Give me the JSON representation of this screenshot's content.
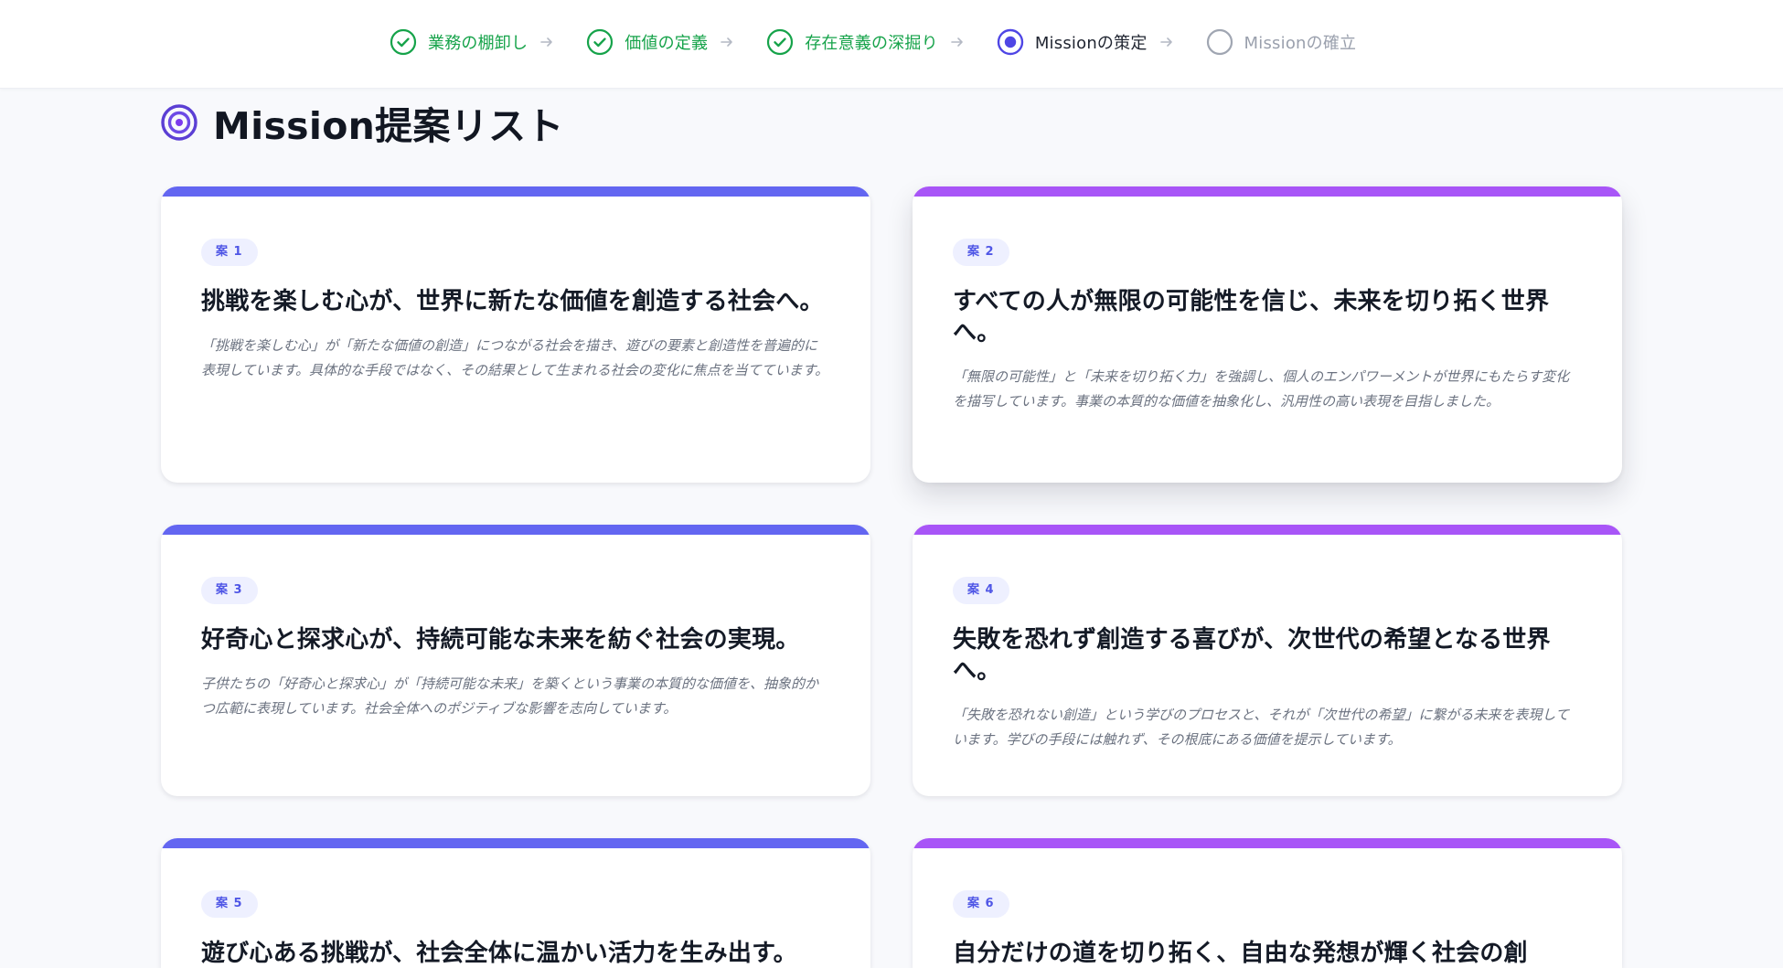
{
  "stepper": {
    "steps": [
      {
        "label": "業務の棚卸し",
        "state": "done",
        "icon": "check-circle-icon"
      },
      {
        "label": "価値の定義",
        "state": "done",
        "icon": "check-circle-icon"
      },
      {
        "label": "存在意義の深掘り",
        "state": "done",
        "icon": "check-circle-icon"
      },
      {
        "label": "Missionの策定",
        "state": "current",
        "icon": "dot-circle-icon"
      },
      {
        "label": "Missionの確立",
        "state": "pending",
        "icon": "empty-circle-icon"
      }
    ],
    "arrow_icon": "arrow-right-icon"
  },
  "page": {
    "title": "Mission提案リスト",
    "title_icon": "target-icon"
  },
  "colors": {
    "accent_blue": "#6366f1",
    "accent_purple": "#a855f7",
    "done_green": "#16a34a",
    "current_indigo": "#4f46e5",
    "pending_gray": "#9aa0ad",
    "badge_bg": "#eef0ff",
    "badge_text": "#4f56e6"
  },
  "proposals": [
    {
      "badge": "案 1",
      "title": "挑戦を楽しむ心が、世界に新たな価値を創造する社会へ。",
      "description": "「挑戦を楽しむ心」が「新たな価値の創造」につながる社会を描き、遊びの要素と創造性を普遍的に表現しています。具体的な手段ではなく、その結果として生まれる社会の変化に焦点を当てています。",
      "accent": "#6366f1"
    },
    {
      "badge": "案 2",
      "title": "すべての人が無限の可能性を信じ、未来を切り拓く世界へ。",
      "description": "「無限の可能性」と「未来を切り拓く力」を強調し、個人のエンパワーメントが世界にもたらす変化を描写しています。事業の本質的な価値を抽象化し、汎用性の高い表現を目指しました。",
      "accent": "#a855f7"
    },
    {
      "badge": "案 3",
      "title": "好奇心と探求心が、持続可能な未来を紡ぐ社会の実現。",
      "description": "子供たちの「好奇心と探求心」が「持続可能な未来」を築くという事業の本質的な価値を、抽象的かつ広範に表現しています。社会全体へのポジティブな影響を志向しています。",
      "accent": "#6366f1"
    },
    {
      "badge": "案 4",
      "title": "失敗を恐れず創造する喜びが、次世代の希望となる世界へ。",
      "description": "「失敗を恐れない創造」という学びのプロセスと、それが「次世代の希望」に繋がる未来を表現しています。学びの手段には触れず、その根底にある価値を提示しています。",
      "accent": "#a855f7"
    },
    {
      "badge": "案 5",
      "title": "遊び心ある挑戦が、社会全体に温かい活力を生み出す。",
      "description": "",
      "accent": "#6366f1"
    },
    {
      "badge": "案 6",
      "title": "自分だけの道を切り拓く、自由な発想が輝く社会の創",
      "description": "",
      "accent": "#a855f7"
    }
  ]
}
